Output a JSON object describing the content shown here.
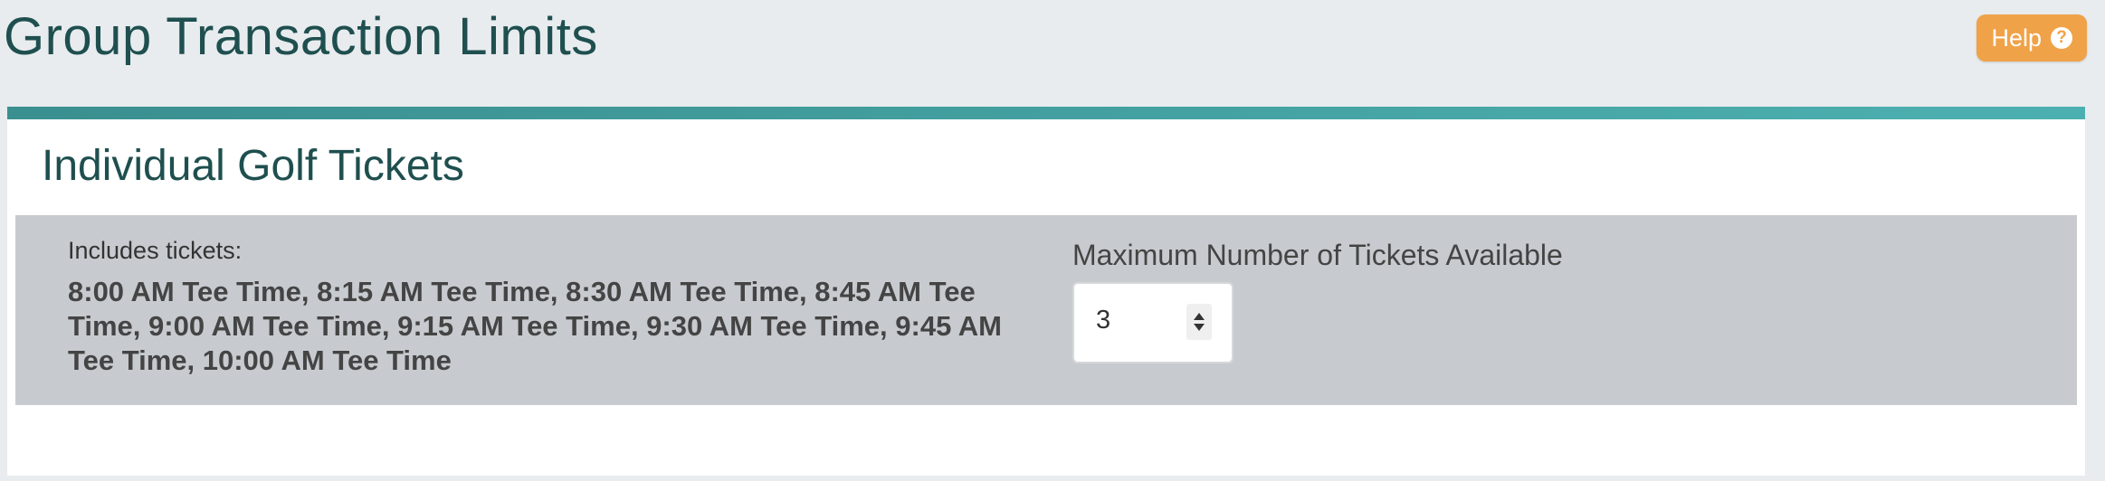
{
  "header": {
    "title": "Group Transaction Limits",
    "help_label": "Help",
    "help_icon": "question-circle-icon"
  },
  "panel": {
    "title": "Individual Golf Tickets",
    "accent_color": "#3f9a9a",
    "includes_label": "Includes tickets:",
    "includes_list": "8:00 AM Tee Time, 8:15 AM Tee Time, 8:30 AM Tee Time, 8:45 AM Tee Time, 9:00 AM Tee Time, 9:15 AM Tee Time, 9:30 AM Tee Time, 9:45 AM Tee Time, 10:00 AM Tee Time",
    "max_label": "Maximum Number of Tickets Available",
    "max_value": "3"
  }
}
